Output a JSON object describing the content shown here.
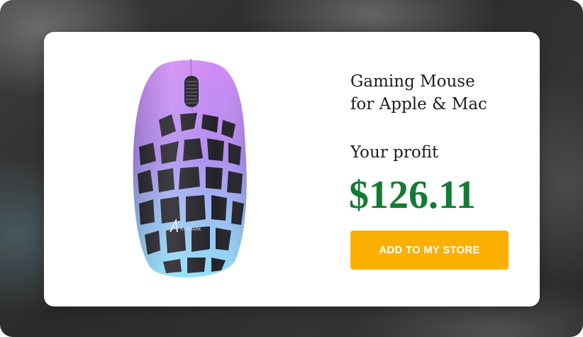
{
  "product": {
    "title_line1": "Gaming Mouse",
    "title_line2": "for Apple & Mac",
    "image_icon": "gaming-mouse-image",
    "image_brand_text": "AT SHARK"
  },
  "pricing": {
    "profit_label": "Your profit",
    "profit_value": "$126.11"
  },
  "actions": {
    "add_to_store_label": "ADD TO MY STORE"
  },
  "colors": {
    "profit_green": "#147a34",
    "cta_orange": "#fbb000",
    "mouse_purple": "#c980f5",
    "mouse_blue": "#8ed8f8"
  }
}
